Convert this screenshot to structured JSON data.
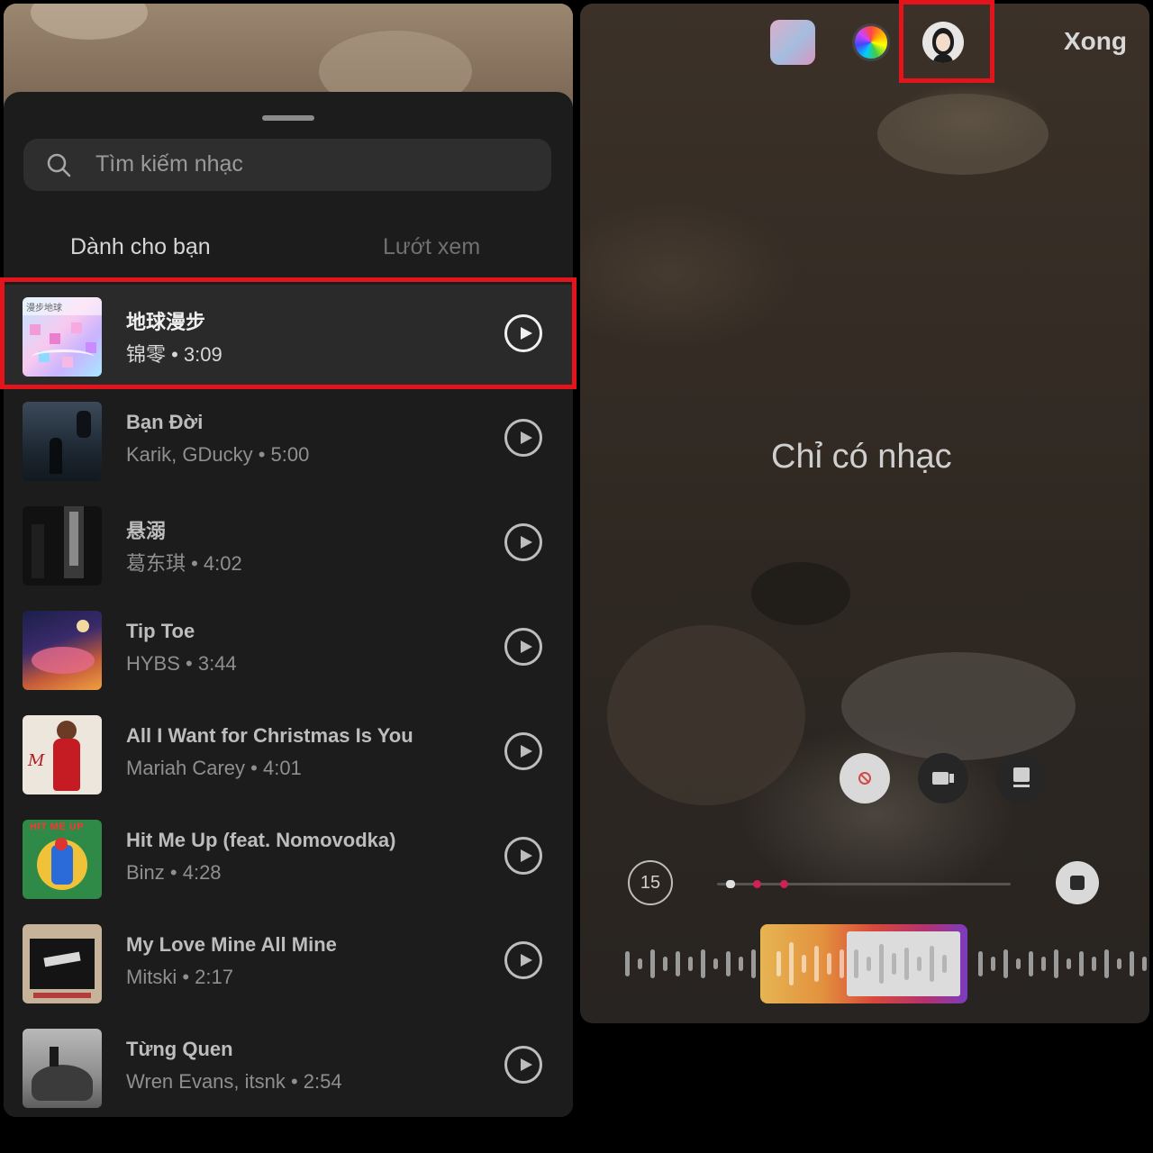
{
  "music_picker": {
    "search": {
      "placeholder": "Tìm kiếm nhạc"
    },
    "tabs": [
      {
        "label": "Dành cho bạn",
        "active": true
      },
      {
        "label": "Lướt xem",
        "active": false
      }
    ],
    "songs": [
      {
        "title": "地球漫步",
        "subtitle": "锦零 • 3:09",
        "selected": true,
        "art_text": "漫步地球"
      },
      {
        "title": "Bạn Đời",
        "subtitle": "Karik, GDucky • 5:00",
        "selected": false
      },
      {
        "title": "悬溺",
        "subtitle": "葛东琪 • 4:02",
        "selected": false
      },
      {
        "title": "Tip Toe",
        "subtitle": "HYBS • 3:44",
        "selected": false
      },
      {
        "title": "All I Want for Christmas Is You",
        "subtitle": "Mariah Carey • 4:01",
        "selected": false
      },
      {
        "title": "Hit Me Up (feat. Nomovodka)",
        "subtitle": "Binz • 4:28",
        "selected": false,
        "art_text": "HIT ME UP"
      },
      {
        "title": "My Love Mine All Mine",
        "subtitle": "Mitski • 2:17",
        "selected": false
      },
      {
        "title": "Từng Quen",
        "subtitle": "Wren Evans, itsnk • 2:54",
        "selected": false
      }
    ],
    "icons": {
      "search": "search-icon",
      "play": "play-icon"
    }
  },
  "editor": {
    "done_label": "Xong",
    "caption": "Chỉ có nhạc",
    "timer_label": "15",
    "toolbar_icons": [
      "sticker-icon",
      "color-wheel-icon",
      "avatar-icon"
    ],
    "modes": [
      "no-video-icon",
      "video-icon",
      "card-icon"
    ]
  },
  "colors": {
    "highlight": "#e4141c",
    "sheet_bg": "#1c1c1c",
    "clip_gradient": [
      "#e6b552",
      "#d8483b",
      "#7b3cc0"
    ]
  }
}
